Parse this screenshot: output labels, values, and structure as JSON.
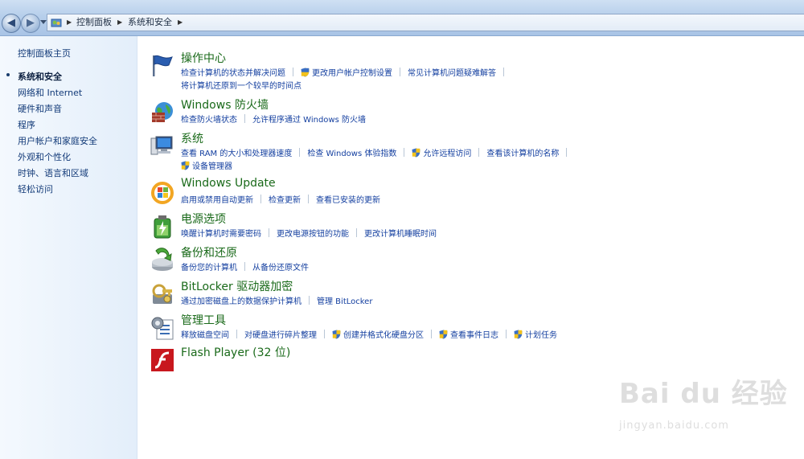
{
  "breadcrumb": {
    "items": [
      "控制面板",
      "系统和安全"
    ]
  },
  "left_nav": {
    "home": "控制面板主页",
    "items": [
      "系统和安全",
      "网络和 Internet",
      "硬件和声音",
      "程序",
      "用户帐户和家庭安全",
      "外观和个性化",
      "时钟、语言和区域",
      "轻松访问"
    ],
    "active_index": 0
  },
  "sections": [
    {
      "title": "操作中心",
      "icon": "action-center-flag-icon",
      "links": [
        "检查计算机的状态并解决问题",
        "更改用户帐户控制设置",
        "常见计算机问题疑难解答"
      ],
      "links2": [
        "将计算机还原到一个较早的时间点"
      ]
    },
    {
      "title": "Windows 防火墙",
      "icon": "firewall-icon",
      "links": [
        "检查防火墙状态",
        "允许程序通过 Windows 防火墙"
      ]
    },
    {
      "title": "系统",
      "icon": "system-computer-icon",
      "links": [
        "查看 RAM 的大小和处理器速度",
        "检查 Windows 体验指数",
        "允许远程访问",
        "查看该计算机的名称"
      ],
      "links2": [
        "设备管理器"
      ]
    },
    {
      "title": "Windows Update",
      "icon": "windows-update-icon",
      "links": [
        "启用或禁用自动更新",
        "检查更新",
        "查看已安装的更新"
      ]
    },
    {
      "title": "电源选项",
      "icon": "power-options-icon",
      "links": [
        "唤醒计算机时需要密码",
        "更改电源按钮的功能",
        "更改计算机睡眠时间"
      ]
    },
    {
      "title": "备份和还原",
      "icon": "backup-restore-icon",
      "links": [
        "备份您的计算机",
        "从备份还原文件"
      ]
    },
    {
      "title": "BitLocker 驱动器加密",
      "icon": "bitlocker-keys-icon",
      "links": [
        "通过加密磁盘上的数据保护计算机",
        "管理 BitLocker"
      ]
    },
    {
      "title": "管理工具",
      "icon": "admin-tools-icon",
      "links": [
        "释放磁盘空间",
        "对硬盘进行碎片整理",
        "创建并格式化硬盘分区",
        "查看事件日志",
        "计划任务"
      ]
    },
    {
      "title": "Flash Player (32 位)",
      "icon": "flash-player-icon"
    }
  ],
  "watermark": {
    "logo": "Bai du 经验",
    "url": "jingyan.baidu.com"
  },
  "colors": {
    "title_green": "#1a6a1a",
    "link_blue": "#1540a0",
    "nav_blue": "#123a78"
  }
}
